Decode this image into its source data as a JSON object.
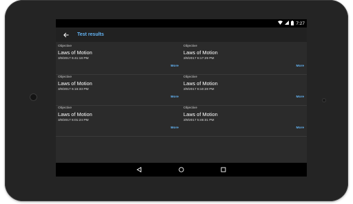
{
  "status_bar": {
    "time": "7:27",
    "icons": [
      "wifi-icon",
      "signal-icon",
      "battery-icon"
    ]
  },
  "app_bar": {
    "title": "Test results",
    "back_icon": "arrow-back-icon"
  },
  "results": [
    {
      "label": "Objective",
      "title": "Laws of Motion",
      "date": "3/9/2017 6:41:18 PM",
      "more": "More"
    },
    {
      "label": "Objective",
      "title": "Laws of Motion",
      "date": "3/9/2017 6:17:29 PM",
      "more": "More"
    },
    {
      "label": "Objective",
      "title": "Laws of Motion",
      "date": "3/9/2017 6:15:33 PM",
      "more": "More"
    },
    {
      "label": "Objective",
      "title": "Laws of Motion",
      "date": "3/9/2017 6:10:28 PM",
      "more": "More"
    },
    {
      "label": "Objective",
      "title": "Laws of Motion",
      "date": "3/9/2017 6:01:24 PM",
      "more": "More"
    },
    {
      "label": "Objective",
      "title": "Laws of Motion",
      "date": "3/9/2017 5:46:31 PM",
      "more": "More"
    }
  ],
  "nav_bar": {
    "buttons": [
      "back-triangle-icon",
      "home-circle-icon",
      "recents-square-icon"
    ]
  },
  "colors": {
    "accent": "#64b5f6",
    "screen_bg": "#2b2b2b",
    "app_bar_bg": "#212121",
    "bezel": "#242424"
  }
}
